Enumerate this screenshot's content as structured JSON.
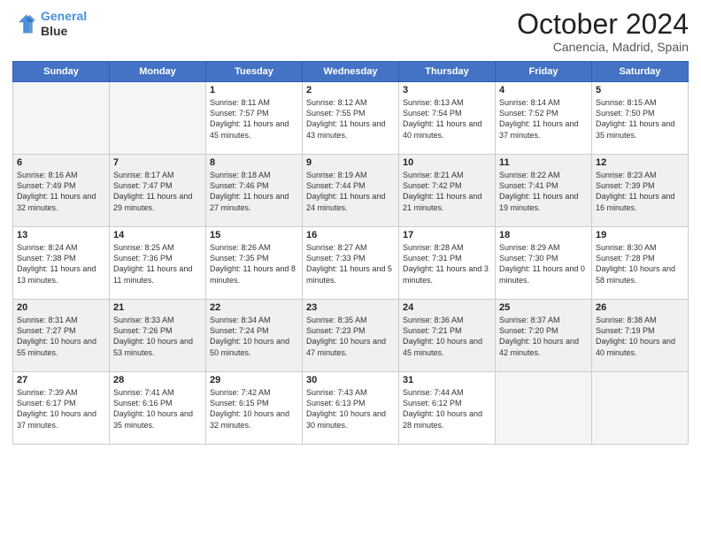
{
  "header": {
    "logo_line1": "General",
    "logo_line2": "Blue",
    "month": "October 2024",
    "location": "Canencia, Madrid, Spain"
  },
  "days_of_week": [
    "Sunday",
    "Monday",
    "Tuesday",
    "Wednesday",
    "Thursday",
    "Friday",
    "Saturday"
  ],
  "weeks": [
    [
      {
        "day": "",
        "info": ""
      },
      {
        "day": "",
        "info": ""
      },
      {
        "day": "1",
        "info": "Sunrise: 8:11 AM\nSunset: 7:57 PM\nDaylight: 11 hours and 45 minutes."
      },
      {
        "day": "2",
        "info": "Sunrise: 8:12 AM\nSunset: 7:55 PM\nDaylight: 11 hours and 43 minutes."
      },
      {
        "day": "3",
        "info": "Sunrise: 8:13 AM\nSunset: 7:54 PM\nDaylight: 11 hours and 40 minutes."
      },
      {
        "day": "4",
        "info": "Sunrise: 8:14 AM\nSunset: 7:52 PM\nDaylight: 11 hours and 37 minutes."
      },
      {
        "day": "5",
        "info": "Sunrise: 8:15 AM\nSunset: 7:50 PM\nDaylight: 11 hours and 35 minutes."
      }
    ],
    [
      {
        "day": "6",
        "info": "Sunrise: 8:16 AM\nSunset: 7:49 PM\nDaylight: 11 hours and 32 minutes."
      },
      {
        "day": "7",
        "info": "Sunrise: 8:17 AM\nSunset: 7:47 PM\nDaylight: 11 hours and 29 minutes."
      },
      {
        "day": "8",
        "info": "Sunrise: 8:18 AM\nSunset: 7:46 PM\nDaylight: 11 hours and 27 minutes."
      },
      {
        "day": "9",
        "info": "Sunrise: 8:19 AM\nSunset: 7:44 PM\nDaylight: 11 hours and 24 minutes."
      },
      {
        "day": "10",
        "info": "Sunrise: 8:21 AM\nSunset: 7:42 PM\nDaylight: 11 hours and 21 minutes."
      },
      {
        "day": "11",
        "info": "Sunrise: 8:22 AM\nSunset: 7:41 PM\nDaylight: 11 hours and 19 minutes."
      },
      {
        "day": "12",
        "info": "Sunrise: 8:23 AM\nSunset: 7:39 PM\nDaylight: 11 hours and 16 minutes."
      }
    ],
    [
      {
        "day": "13",
        "info": "Sunrise: 8:24 AM\nSunset: 7:38 PM\nDaylight: 11 hours and 13 minutes."
      },
      {
        "day": "14",
        "info": "Sunrise: 8:25 AM\nSunset: 7:36 PM\nDaylight: 11 hours and 11 minutes."
      },
      {
        "day": "15",
        "info": "Sunrise: 8:26 AM\nSunset: 7:35 PM\nDaylight: 11 hours and 8 minutes."
      },
      {
        "day": "16",
        "info": "Sunrise: 8:27 AM\nSunset: 7:33 PM\nDaylight: 11 hours and 5 minutes."
      },
      {
        "day": "17",
        "info": "Sunrise: 8:28 AM\nSunset: 7:31 PM\nDaylight: 11 hours and 3 minutes."
      },
      {
        "day": "18",
        "info": "Sunrise: 8:29 AM\nSunset: 7:30 PM\nDaylight: 11 hours and 0 minutes."
      },
      {
        "day": "19",
        "info": "Sunrise: 8:30 AM\nSunset: 7:28 PM\nDaylight: 10 hours and 58 minutes."
      }
    ],
    [
      {
        "day": "20",
        "info": "Sunrise: 8:31 AM\nSunset: 7:27 PM\nDaylight: 10 hours and 55 minutes."
      },
      {
        "day": "21",
        "info": "Sunrise: 8:33 AM\nSunset: 7:26 PM\nDaylight: 10 hours and 53 minutes."
      },
      {
        "day": "22",
        "info": "Sunrise: 8:34 AM\nSunset: 7:24 PM\nDaylight: 10 hours and 50 minutes."
      },
      {
        "day": "23",
        "info": "Sunrise: 8:35 AM\nSunset: 7:23 PM\nDaylight: 10 hours and 47 minutes."
      },
      {
        "day": "24",
        "info": "Sunrise: 8:36 AM\nSunset: 7:21 PM\nDaylight: 10 hours and 45 minutes."
      },
      {
        "day": "25",
        "info": "Sunrise: 8:37 AM\nSunset: 7:20 PM\nDaylight: 10 hours and 42 minutes."
      },
      {
        "day": "26",
        "info": "Sunrise: 8:38 AM\nSunset: 7:19 PM\nDaylight: 10 hours and 40 minutes."
      }
    ],
    [
      {
        "day": "27",
        "info": "Sunrise: 7:39 AM\nSunset: 6:17 PM\nDaylight: 10 hours and 37 minutes."
      },
      {
        "day": "28",
        "info": "Sunrise: 7:41 AM\nSunset: 6:16 PM\nDaylight: 10 hours and 35 minutes."
      },
      {
        "day": "29",
        "info": "Sunrise: 7:42 AM\nSunset: 6:15 PM\nDaylight: 10 hours and 32 minutes."
      },
      {
        "day": "30",
        "info": "Sunrise: 7:43 AM\nSunset: 6:13 PM\nDaylight: 10 hours and 30 minutes."
      },
      {
        "day": "31",
        "info": "Sunrise: 7:44 AM\nSunset: 6:12 PM\nDaylight: 10 hours and 28 minutes."
      },
      {
        "day": "",
        "info": ""
      },
      {
        "day": "",
        "info": ""
      }
    ]
  ]
}
